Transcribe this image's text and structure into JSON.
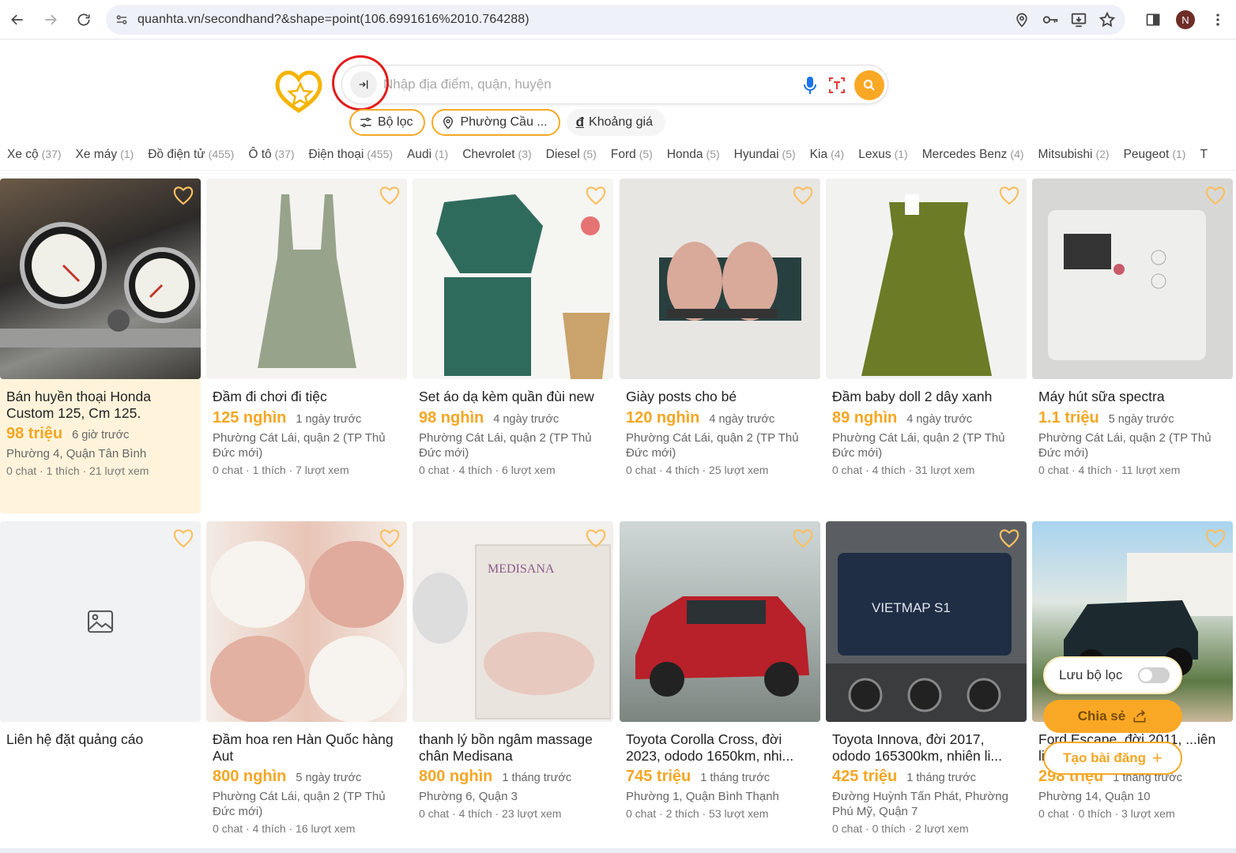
{
  "browser": {
    "url": "quanhta.vn/secondhand?&shape=point(106.6991616%2010.764288)",
    "avatar_letter": "N"
  },
  "search": {
    "placeholder": "Nhập địa điểm, quận, huyện"
  },
  "chips": [
    {
      "label": "Bộ lọc",
      "icon": "sliders-icon"
    },
    {
      "label": "Phường Cầu ...",
      "icon": "location-pin-icon"
    },
    {
      "label": "Khoảng giá",
      "icon": "dong-currency-icon"
    }
  ],
  "categories": [
    {
      "name": "Xe cộ",
      "count": "(37)"
    },
    {
      "name": "Xe máy",
      "count": "(1)"
    },
    {
      "name": "Đồ điện tử",
      "count": "(455)"
    },
    {
      "name": "Ô tô",
      "count": "(37)"
    },
    {
      "name": "Điện thoại",
      "count": "(455)"
    },
    {
      "name": "Audi",
      "count": "(1)"
    },
    {
      "name": "Chevrolet",
      "count": "(3)"
    },
    {
      "name": "Diesel",
      "count": "(5)"
    },
    {
      "name": "Ford",
      "count": "(5)"
    },
    {
      "name": "Honda",
      "count": "(5)"
    },
    {
      "name": "Hyundai",
      "count": "(5)"
    },
    {
      "name": "Kia",
      "count": "(4)"
    },
    {
      "name": "Lexus",
      "count": "(1)"
    },
    {
      "name": "Mercedes Benz",
      "count": "(4)"
    },
    {
      "name": "Mitsubishi",
      "count": "(2)"
    },
    {
      "name": "Peugeot",
      "count": "(1)"
    },
    {
      "name": "T",
      "count": ""
    }
  ],
  "listings": [
    {
      "title": "Bán huyền thoại Honda Custom 125, Cm 125.",
      "price": "98 triệu",
      "time": "6 giờ trước",
      "location": "Phường 4, Quận Tân Bình",
      "stats": "0 chat · 1 thích · 21 lượt xem"
    },
    {
      "title": "Đầm đi chơi đi tiệc",
      "price": "125 nghìn",
      "time": "1 ngày trước",
      "location": "Phường Cát Lái, quận 2 (TP Thủ Đức mới)",
      "stats": "0 chat · 1 thích · 7 lượt xem"
    },
    {
      "title": "Set áo dạ kèm quần đùi new",
      "price": "98 nghìn",
      "time": "4 ngày trước",
      "location": "Phường Cát Lái, quận 2 (TP Thủ Đức mới)",
      "stats": "0 chat · 4 thích · 6 lượt xem"
    },
    {
      "title": "Giày posts cho bé",
      "price": "120 nghìn",
      "time": "4 ngày trước",
      "location": "Phường Cát Lái, quận 2 (TP Thủ Đức mới)",
      "stats": "0 chat · 4 thích · 25 lượt xem"
    },
    {
      "title": "Đầm baby doll 2 dây xanh",
      "price": "89 nghìn",
      "time": "4 ngày trước",
      "location": "Phường Cát Lái, quận 2 (TP Thủ Đức mới)",
      "stats": "0 chat · 4 thích · 31 lượt xem"
    },
    {
      "title": "Máy hút sữa spectra",
      "price": "1.1 triệu",
      "time": "5 ngày trước",
      "location": "Phường Cát Lái, quận 2 (TP Thủ Đức mới)",
      "stats": "0 chat · 4 thích · 11 lượt xem"
    },
    {
      "title": "Liên hệ đặt quảng cáo"
    },
    {
      "title": "Đầm hoa ren Hàn Quốc hàng Aut",
      "price": "800 nghìn",
      "time": "5 ngày trước",
      "location": "Phường Cát Lái, quận 2 (TP Thủ Đức mới)",
      "stats": "0 chat · 4 thích · 16 lượt xem"
    },
    {
      "title": "thanh lý bồn ngâm massage chân Medisana",
      "price": "800 nghìn",
      "time": "1 tháng trước",
      "location": "Phường 6, Quận 3",
      "stats": "0 chat · 4 thích · 23 lượt xem"
    },
    {
      "title": "Toyota Corolla Cross, đời 2023, ododo 1650km, nhi...",
      "price": "745 triệu",
      "time": "1 tháng trước",
      "location": "Phường 1, Quận Bình Thạnh",
      "stats": "0 chat · 2 thích · 53 lượt xem"
    },
    {
      "title": "Toyota Innova, đời 2017, ododo 165300km, nhiên li...",
      "price": "425 triệu",
      "time": "1 tháng trước",
      "location": "Đường Huỳnh Tấn Phát, Phường Phú Mỹ, Quận 7",
      "stats": "0 chat · 0 thích · 2 lượt xem"
    },
    {
      "title": "Ford Escape, đời 2011, ...iên liệ...",
      "price": "298 triệu",
      "time": "1 tháng trước",
      "location": "Phường 14, Quận 10",
      "stats": "0 chat · 0 thích · 3 lượt xem"
    }
  ],
  "floating": {
    "save_filter": "Lưu bộ lọc",
    "share": "Chia sẻ",
    "create_post": "Tạo bài đăng"
  },
  "colors": {
    "accent": "#f9a825",
    "price": "#f5a623",
    "highlight_bg": "#fff4db"
  }
}
